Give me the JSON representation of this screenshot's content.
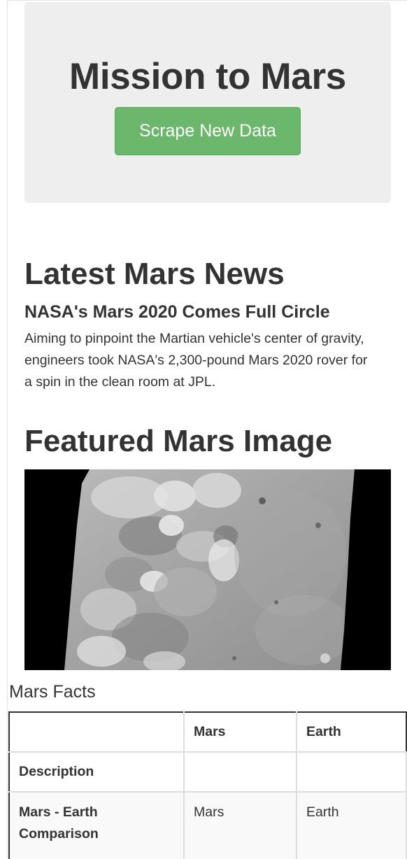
{
  "jumbotron": {
    "title": "Mission to Mars",
    "button_label": "Scrape New Data"
  },
  "news": {
    "heading": "Latest Mars News",
    "title": "NASA's Mars 2020 Comes Full Circle",
    "paragraph": "Aiming to pinpoint the Martian vehicle's center of gravity, engineers took NASA's 2,300-pound Mars 2020 rover for a spin in the clean room at JPL."
  },
  "featured_image": {
    "heading": "Featured Mars Image"
  },
  "facts": {
    "caption": "Mars Facts",
    "columns": [
      "",
      "Mars",
      "Earth"
    ],
    "rows": [
      {
        "label": "Description",
        "mars": "",
        "earth": ""
      },
      {
        "label": "Mars - Earth Comparison",
        "mars": "Mars",
        "earth": "Earth"
      }
    ]
  },
  "colors": {
    "button_bg": "#6bb76b",
    "jumbotron_bg": "#eeeeee",
    "text": "#333333"
  }
}
